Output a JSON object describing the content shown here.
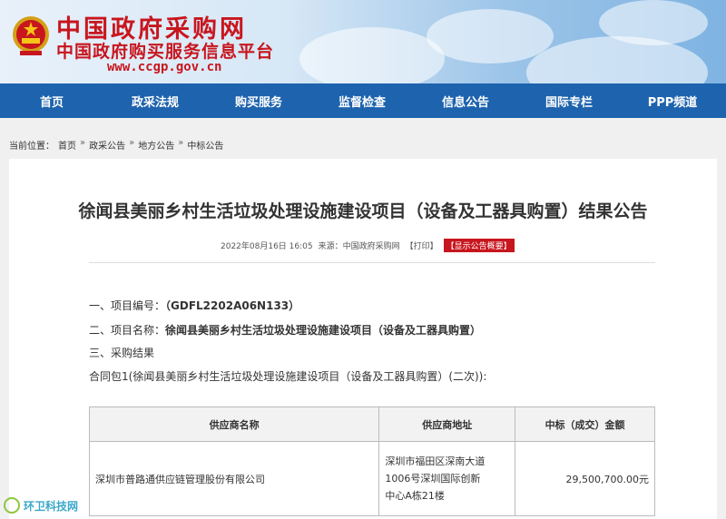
{
  "header": {
    "title": "中国政府采购网",
    "subtitle": "中国政府购买服务信息平台",
    "url": "www.ccgp.gov.cn"
  },
  "nav": {
    "items": [
      "首页",
      "政采法规",
      "购买服务",
      "监督检查",
      "信息公告",
      "国际专栏",
      "PPP频道"
    ]
  },
  "breadcrumb": {
    "prefix": "当前位置：",
    "items": [
      "首页",
      "政采公告",
      "地方公告",
      "中标公告"
    ],
    "separator": "»"
  },
  "article": {
    "title": "徐闻县美丽乡村生活垃圾处理设施建设项目（设备及工器具购置）结果公告",
    "date": "2022年08月16日 16:05",
    "source_label": "来源：",
    "source": "中国政府采购网",
    "print_label": "【打印】",
    "display_label": "【显示公告概要】",
    "project_no_label": "一、项目编号：",
    "project_no": "（GDFL2202A06N133）",
    "project_name_label": "二、项目名称：",
    "project_name": "徐闻县美丽乡村生活垃圾处理设施建设项目（设备及工器具购置）",
    "result_heading": "三、采购结果",
    "package_line": "合同包1(徐闻县美丽乡村生活垃圾处理设施建设项目（设备及工器具购置）(二次)):"
  },
  "table": {
    "headers": [
      "供应商名称",
      "供应商地址",
      "中标（成交）金额"
    ],
    "rows": [
      {
        "name": "深圳市普路通供应链管理股份有限公司",
        "address_lines": [
          "深圳市福田区深南大道",
          "1006号深圳国际创新",
          "中心A栋21楼"
        ],
        "amount": "29,500,700.00元"
      }
    ]
  },
  "watermark": {
    "text": "环卫科技网"
  },
  "colors": {
    "brand_red": "#c8161e",
    "nav_blue": "#1e63ad"
  }
}
